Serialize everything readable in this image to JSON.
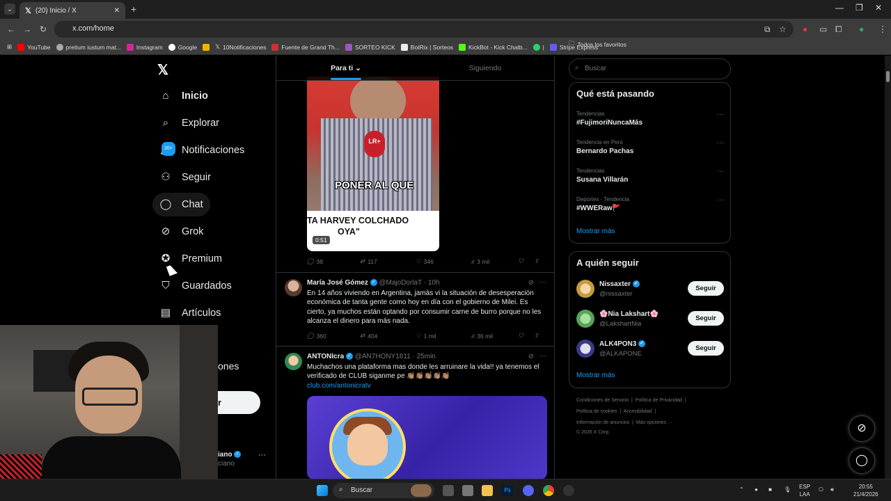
{
  "browser": {
    "tab_title": "(20) Inicio / X",
    "url": "x.com/home",
    "bookmarks": [
      "YouTube",
      "pretium iustum mat...",
      "Instagram",
      "Google",
      "10Notificaciones",
      "Fuente de Grand Th...",
      "SORTEO KICK",
      "BotRix | Sorteos",
      "KickBot - Kick Chatb...",
      "|",
      "Stripe Express"
    ],
    "bookmarks_right": "Todos los favoritos"
  },
  "sidebar": {
    "items": [
      {
        "label": "Inicio",
        "icon": "home-icon"
      },
      {
        "label": "Explorar",
        "icon": "search-icon"
      },
      {
        "label": "Notificaciones",
        "icon": "bell-icon",
        "badge": "20+"
      },
      {
        "label": "Seguir",
        "icon": "follow-icon"
      },
      {
        "label": "Chat",
        "icon": "chat-icon"
      },
      {
        "label": "Grok",
        "icon": "grok-icon"
      },
      {
        "label": "Premium",
        "icon": "premium-icon"
      },
      {
        "label": "Guardados",
        "icon": "bookmark-icon"
      },
      {
        "label": "Artículos",
        "icon": "article-icon"
      }
    ],
    "partial_label": "ones",
    "post_partial": "r",
    "profile_partial": "iano",
    "profile_handle_partial": "ciano"
  },
  "feed": {
    "tabs": [
      "Para ti",
      "Siguiendo"
    ],
    "video": {
      "mic_label": "LR+",
      "caption_main": "PONER AL QUE",
      "caption_line1": "TA HARVEY COLCHADO",
      "caption_line2": "OYA\"",
      "duration": "0:51"
    },
    "video_actions": {
      "replies": "38",
      "reposts": "117",
      "likes": "346",
      "views": "3 mil"
    },
    "tweet1": {
      "name": "María José Gómez",
      "handle": "@MajoDorlaT",
      "time": "· 10h",
      "text": "En 14 años viviendo en Argentina, jamás vi la situación de desesperación económica de tanta gente como hoy en día con el gobierno de Milei. Es cierto, ya muchos están optando por consumir carne de burro porque no les alcanza el dinero para más nada.",
      "replies": "360",
      "reposts": "404",
      "likes": "1 mil",
      "views": "36 mil"
    },
    "tweet2": {
      "name": "ANTONIcra",
      "handle": "@AN7HONY1811",
      "time": "· 25min",
      "text": "Muchachos una plataforma mas donde les arruinare la vida!! ya tenemos el verificado de CLUB siganme pe 👏🏽👏🏽👏🏽👏🏽👏🏽",
      "link": "club.com/antonicratv"
    }
  },
  "right": {
    "search_placeholder": "Buscar",
    "trends_title": "Qué está pasando",
    "trends": [
      {
        "category": "Tendencias",
        "name": "#FujimoriNuncaMás"
      },
      {
        "category": "Tendencia en Perú",
        "name": "Bernardo Pachas"
      },
      {
        "category": "Tendencias",
        "name": "Susana Villarán"
      },
      {
        "category": "Deportes · Tendencia",
        "name": "#WWERaw🚩"
      }
    ],
    "show_more": "Mostrar más",
    "follow_title": "A quién seguir",
    "follow": [
      {
        "name": "Nissaxter",
        "handle": "@nissaxter"
      },
      {
        "name": "🌸Nia Lakshart🌸",
        "handle": "@LakshartNia"
      },
      {
        "name": "ALK4PON3",
        "handle": "@ALKAPONE"
      }
    ],
    "follow_button": "Seguir",
    "footer": {
      "line1a": "Condiciones de Servicio",
      "line1b": "Política de Privacidad",
      "line2a": "Política de cookies",
      "line2b": "Accesibilidad",
      "line3a": "Información de anuncios",
      "line3b": "Más opciones ···",
      "line4": "© 2026 X Corp."
    }
  },
  "taskbar": {
    "search": "Buscar",
    "lang1": "ESP",
    "lang2": "LAA",
    "time": "20:55",
    "date": "21/4/2026"
  },
  "colors": {
    "accent": "#1d9bf0",
    "background": "#000000",
    "border": "#2f3336"
  }
}
